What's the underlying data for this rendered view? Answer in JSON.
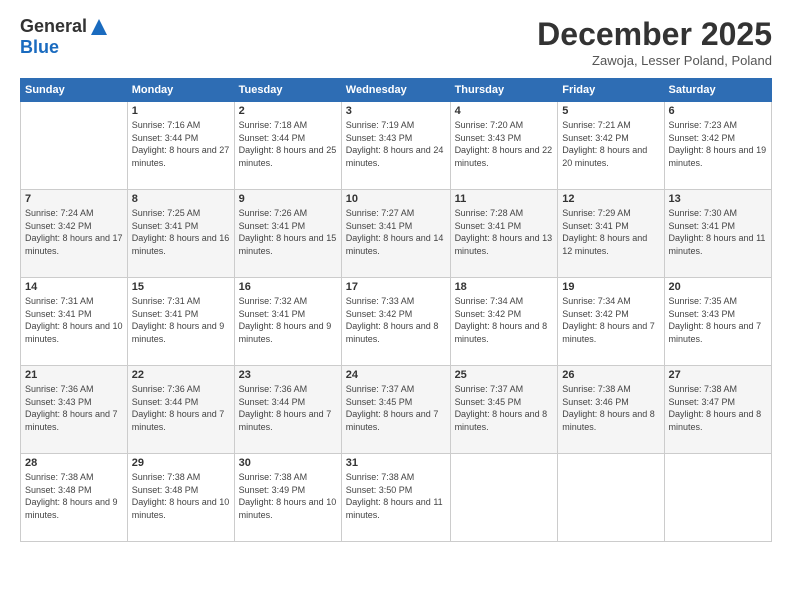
{
  "header": {
    "logo_general": "General",
    "logo_blue": "Blue",
    "month_title": "December 2025",
    "location": "Zawoja, Lesser Poland, Poland"
  },
  "calendar": {
    "days_of_week": [
      "Sunday",
      "Monday",
      "Tuesday",
      "Wednesday",
      "Thursday",
      "Friday",
      "Saturday"
    ],
    "weeks": [
      [
        {
          "day": "",
          "sunrise": "",
          "sunset": "",
          "daylight": ""
        },
        {
          "day": "1",
          "sunrise": "Sunrise: 7:16 AM",
          "sunset": "Sunset: 3:44 PM",
          "daylight": "Daylight: 8 hours and 27 minutes."
        },
        {
          "day": "2",
          "sunrise": "Sunrise: 7:18 AM",
          "sunset": "Sunset: 3:44 PM",
          "daylight": "Daylight: 8 hours and 25 minutes."
        },
        {
          "day": "3",
          "sunrise": "Sunrise: 7:19 AM",
          "sunset": "Sunset: 3:43 PM",
          "daylight": "Daylight: 8 hours and 24 minutes."
        },
        {
          "day": "4",
          "sunrise": "Sunrise: 7:20 AM",
          "sunset": "Sunset: 3:43 PM",
          "daylight": "Daylight: 8 hours and 22 minutes."
        },
        {
          "day": "5",
          "sunrise": "Sunrise: 7:21 AM",
          "sunset": "Sunset: 3:42 PM",
          "daylight": "Daylight: 8 hours and 20 minutes."
        },
        {
          "day": "6",
          "sunrise": "Sunrise: 7:23 AM",
          "sunset": "Sunset: 3:42 PM",
          "daylight": "Daylight: 8 hours and 19 minutes."
        }
      ],
      [
        {
          "day": "7",
          "sunrise": "Sunrise: 7:24 AM",
          "sunset": "Sunset: 3:42 PM",
          "daylight": "Daylight: 8 hours and 17 minutes."
        },
        {
          "day": "8",
          "sunrise": "Sunrise: 7:25 AM",
          "sunset": "Sunset: 3:41 PM",
          "daylight": "Daylight: 8 hours and 16 minutes."
        },
        {
          "day": "9",
          "sunrise": "Sunrise: 7:26 AM",
          "sunset": "Sunset: 3:41 PM",
          "daylight": "Daylight: 8 hours and 15 minutes."
        },
        {
          "day": "10",
          "sunrise": "Sunrise: 7:27 AM",
          "sunset": "Sunset: 3:41 PM",
          "daylight": "Daylight: 8 hours and 14 minutes."
        },
        {
          "day": "11",
          "sunrise": "Sunrise: 7:28 AM",
          "sunset": "Sunset: 3:41 PM",
          "daylight": "Daylight: 8 hours and 13 minutes."
        },
        {
          "day": "12",
          "sunrise": "Sunrise: 7:29 AM",
          "sunset": "Sunset: 3:41 PM",
          "daylight": "Daylight: 8 hours and 12 minutes."
        },
        {
          "day": "13",
          "sunrise": "Sunrise: 7:30 AM",
          "sunset": "Sunset: 3:41 PM",
          "daylight": "Daylight: 8 hours and 11 minutes."
        }
      ],
      [
        {
          "day": "14",
          "sunrise": "Sunrise: 7:31 AM",
          "sunset": "Sunset: 3:41 PM",
          "daylight": "Daylight: 8 hours and 10 minutes."
        },
        {
          "day": "15",
          "sunrise": "Sunrise: 7:31 AM",
          "sunset": "Sunset: 3:41 PM",
          "daylight": "Daylight: 8 hours and 9 minutes."
        },
        {
          "day": "16",
          "sunrise": "Sunrise: 7:32 AM",
          "sunset": "Sunset: 3:41 PM",
          "daylight": "Daylight: 8 hours and 9 minutes."
        },
        {
          "day": "17",
          "sunrise": "Sunrise: 7:33 AM",
          "sunset": "Sunset: 3:42 PM",
          "daylight": "Daylight: 8 hours and 8 minutes."
        },
        {
          "day": "18",
          "sunrise": "Sunrise: 7:34 AM",
          "sunset": "Sunset: 3:42 PM",
          "daylight": "Daylight: 8 hours and 8 minutes."
        },
        {
          "day": "19",
          "sunrise": "Sunrise: 7:34 AM",
          "sunset": "Sunset: 3:42 PM",
          "daylight": "Daylight: 8 hours and 7 minutes."
        },
        {
          "day": "20",
          "sunrise": "Sunrise: 7:35 AM",
          "sunset": "Sunset: 3:43 PM",
          "daylight": "Daylight: 8 hours and 7 minutes."
        }
      ],
      [
        {
          "day": "21",
          "sunrise": "Sunrise: 7:36 AM",
          "sunset": "Sunset: 3:43 PM",
          "daylight": "Daylight: 8 hours and 7 minutes."
        },
        {
          "day": "22",
          "sunrise": "Sunrise: 7:36 AM",
          "sunset": "Sunset: 3:44 PM",
          "daylight": "Daylight: 8 hours and 7 minutes."
        },
        {
          "day": "23",
          "sunrise": "Sunrise: 7:36 AM",
          "sunset": "Sunset: 3:44 PM",
          "daylight": "Daylight: 8 hours and 7 minutes."
        },
        {
          "day": "24",
          "sunrise": "Sunrise: 7:37 AM",
          "sunset": "Sunset: 3:45 PM",
          "daylight": "Daylight: 8 hours and 7 minutes."
        },
        {
          "day": "25",
          "sunrise": "Sunrise: 7:37 AM",
          "sunset": "Sunset: 3:45 PM",
          "daylight": "Daylight: 8 hours and 8 minutes."
        },
        {
          "day": "26",
          "sunrise": "Sunrise: 7:38 AM",
          "sunset": "Sunset: 3:46 PM",
          "daylight": "Daylight: 8 hours and 8 minutes."
        },
        {
          "day": "27",
          "sunrise": "Sunrise: 7:38 AM",
          "sunset": "Sunset: 3:47 PM",
          "daylight": "Daylight: 8 hours and 8 minutes."
        }
      ],
      [
        {
          "day": "28",
          "sunrise": "Sunrise: 7:38 AM",
          "sunset": "Sunset: 3:48 PM",
          "daylight": "Daylight: 8 hours and 9 minutes."
        },
        {
          "day": "29",
          "sunrise": "Sunrise: 7:38 AM",
          "sunset": "Sunset: 3:48 PM",
          "daylight": "Daylight: 8 hours and 10 minutes."
        },
        {
          "day": "30",
          "sunrise": "Sunrise: 7:38 AM",
          "sunset": "Sunset: 3:49 PM",
          "daylight": "Daylight: 8 hours and 10 minutes."
        },
        {
          "day": "31",
          "sunrise": "Sunrise: 7:38 AM",
          "sunset": "Sunset: 3:50 PM",
          "daylight": "Daylight: 8 hours and 11 minutes."
        },
        {
          "day": "",
          "sunrise": "",
          "sunset": "",
          "daylight": ""
        },
        {
          "day": "",
          "sunrise": "",
          "sunset": "",
          "daylight": ""
        },
        {
          "day": "",
          "sunrise": "",
          "sunset": "",
          "daylight": ""
        }
      ]
    ]
  }
}
